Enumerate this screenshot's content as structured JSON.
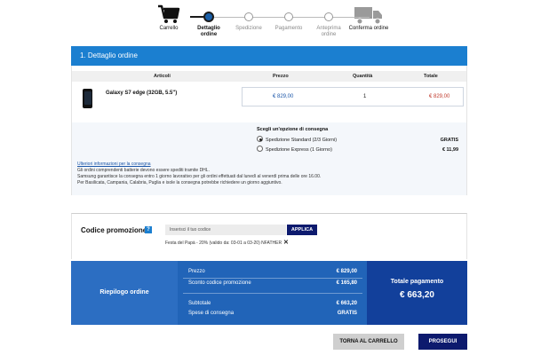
{
  "stepper": {
    "steps": [
      {
        "label": "Carrello",
        "icon": "cart-icon"
      },
      {
        "label": "Dettaglio ordine",
        "line2": "ordine",
        "line1": "Dettaglio"
      },
      {
        "label": "Spedizione"
      },
      {
        "label": "Pagamento"
      },
      {
        "label1": "Anteprima",
        "label2": "ordine"
      },
      {
        "label": "Conferma ordine",
        "icon": "truck-icon"
      }
    ]
  },
  "section": {
    "title": "1. Dettaglio ordine"
  },
  "table": {
    "headers": {
      "articoli": "Articoli",
      "prezzo": "Prezzo",
      "quantita": "Quantità",
      "totale": "Totale"
    },
    "rows": [
      {
        "product": "Galaxy S7 edge (32GB, 5.5\")",
        "price": "€ 829,00",
        "qty": "1",
        "total": "€ 829,00"
      }
    ]
  },
  "shipping": {
    "title": "Scegli un'opzione di consegna",
    "options": [
      {
        "label": "Spedizione Standard  (2/3 Giorni)",
        "price": "GRATIS",
        "selected": true
      },
      {
        "label": "Spedizione Express  (1 Giorno)",
        "price": "€ 11,99",
        "selected": false
      }
    ],
    "info_link": "Ulteriori informazioni per la consegna",
    "info_lines": [
      "Gli ordini comprendenti batterie devono essere spediti tramite DHL.",
      "Samsung garantisce la consegna entro 1 giorno lavorativo per gli ordini effettuati dal lunedì al venerdì prima delle ore 16.00.",
      "Per Basilicata, Campania, Calabria, Puglia e isole la consegna potrebbe richiedere un giorno aggiuntivo."
    ]
  },
  "promo": {
    "title": "Codice promozione",
    "help": "?",
    "placeholder": "Inserisci il tuo codice",
    "apply_label": "APPLICA",
    "applied": "Festa del Papà - 20% (valido da: 03-01 a 03-20) NFATHER"
  },
  "summary": {
    "label": "Riepilogo ordine",
    "rows": [
      {
        "label": "Prezzo",
        "value": "€ 829,00"
      },
      {
        "label": "Sconto codice promozione",
        "value": "€ 165,80"
      },
      {
        "label": "Subtotale",
        "value": "€ 663,20"
      },
      {
        "label": "Spese di consegna",
        "value": "GRATIS"
      }
    ],
    "total_label": "Totale pagamento",
    "total_value": "€ 663,20"
  },
  "buttons": {
    "back": "TORNA AL CARRELLO",
    "next": "PROSEGUI"
  },
  "colors": {
    "accent": "#1b7fd0",
    "navy": "#0d1a6e",
    "total_bg": "#12409b",
    "price_red": "#c0392b"
  }
}
